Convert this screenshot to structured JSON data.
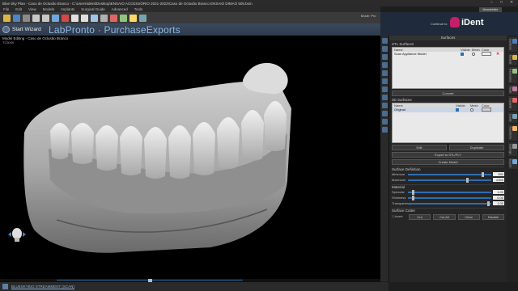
{
  "window": {
    "title": "Blue Sky Plan - Caso de Oclusão Branco - C:\\Users\\Ident\\Desktop\\ENSAIO ACCESSÓRIO 2021-2022\\Caso de Oclusão Branco ENSAIO DIMAO 505.bsm"
  },
  "menu": [
    "File",
    "Edit",
    "View",
    "Models",
    "Implants",
    "Surgical Guide",
    "Advanced",
    "Tools"
  ],
  "toolbar": {
    "mode_label": "Mode: Pro",
    "newsletter": "Newsletter"
  },
  "banner": {
    "start_wizard": "Start Wizard",
    "brand_left": "LabPronto",
    "brand_sep": "·",
    "brand_right": "PurchaseExports"
  },
  "logo": {
    "brand": "iDent",
    "tagline": "Continue to"
  },
  "viewport": {
    "title": "Model Editing - Caso de Oclusão Branco",
    "subtitle": "TC5040"
  },
  "progress": {
    "value": 0.5
  },
  "status": {
    "link": "BLUESKYBIO STREAMMENT (SCAN)"
  },
  "panel": {
    "header": "Surfaces",
    "stl_section": "STL Surfaces",
    "stl_columns": [
      "Name",
      "Visible",
      "Mesh",
      "Color"
    ],
    "stl_rows": [
      {
        "name": "Scan Appliance Model"
      }
    ],
    "stl_button": "Convert",
    "surfaces_section": "3D Surfaces",
    "surf_columns": [
      "Name",
      "Visible",
      "Mesh",
      "Color"
    ],
    "surf_rows": [
      {
        "name": "Original"
      }
    ],
    "btn_edit": "Edit",
    "btn_duplicate": "Duplicate",
    "btn_export": "Export to STL/PLY",
    "btn_create": "Create Model",
    "definition": "Surface Definition",
    "def_rows": [
      {
        "label": "Minimum",
        "value": "990"
      },
      {
        "label": "Maximum",
        "value": "2999"
      }
    ],
    "material": "Material",
    "mat_rows": [
      {
        "label": "Specular",
        "value": "1.00"
      },
      {
        "label": "Shininess",
        "value": "0.00"
      },
      {
        "label": "Transparency",
        "value": "1.00"
      }
    ],
    "cutter": "Surface Cutter",
    "cutter_invert": "Invert",
    "cutter_buttons": [
      "Cut",
      "Cut All",
      "Clear",
      "Disable"
    ]
  },
  "side_tabs": [
    "Surfaces",
    "Models",
    "Panorama",
    "Tools",
    "Implants",
    "Guide",
    "Transform",
    "Settings",
    "Export"
  ]
}
